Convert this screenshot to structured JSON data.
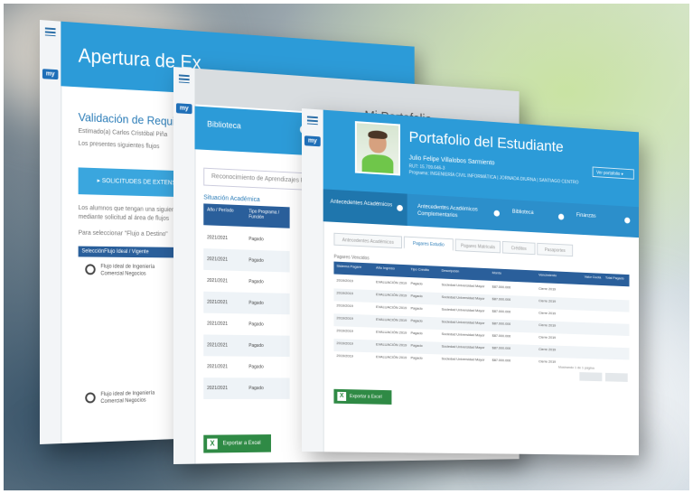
{
  "app": {
    "logo_text": "my"
  },
  "window_admission": {
    "title": "Apertura de Ex",
    "heading": "Validación de Requi",
    "line1": "Estimado(a) Carlos Cristóbal Piña",
    "line2": "Los presentes siguientes flujos",
    "bar_text": "▸ SOLICITUDES DE EXTENSIÓN",
    "line3": "Los alumnos que tengan una siguiente",
    "line4": "mediante solicitud al área de flujos",
    "line5": "Para seleccionar \"Flujo a Destino\"",
    "table_headers": [
      "Selección",
      "Flujo Ideal / Vigente"
    ],
    "rows": [
      {
        "text": "Flujo ideal de Ingeniería Comercial Negocios"
      },
      {
        "text": "Flujo ideal de Ingeniería Comercial Negocios"
      }
    ]
  },
  "window_library": {
    "title": "Mi Portafolio",
    "tab_label": "Biblioteca",
    "search_placeholder": "Reconocimiento de Aprendizajes Previos",
    "subheading": "Situación Académica",
    "table_headers": [
      "Año / Período",
      "Tipo Programa / Función"
    ],
    "rows": [
      {
        "period": "2021/2021",
        "status": "Pagado"
      },
      {
        "period": "2021/2021",
        "status": "Pagado"
      },
      {
        "period": "2021/2021",
        "status": "Pagado"
      },
      {
        "period": "2021/2021",
        "status": "Pagado"
      },
      {
        "period": "2021/2021",
        "status": "Pagado"
      },
      {
        "period": "2021/2021",
        "status": "Pagado"
      },
      {
        "period": "2021/2021",
        "status": "Pagado"
      },
      {
        "period": "2021/2021",
        "status": "Pagado"
      }
    ],
    "excel_button": "Exportar a Excel"
  },
  "window_portfolio": {
    "title": "Portafolio del Estudiante",
    "student_name": "Julio Felipe Villalobos Sarmiento",
    "rut": "RUT: 15.709.646-3",
    "program": "Programa: INGENIERÍA CIVIL INFORMÁTICA  |  JORNADA DIURNA  |  SANTIAGO CENTRO",
    "select_label": "Ver portafolio ▾",
    "nav": [
      {
        "label": "Antecedentes Académicos"
      },
      {
        "label": "Antecedentes Académicos Complementarios"
      },
      {
        "label": "Biblioteca"
      },
      {
        "label": "Finanzas"
      }
    ],
    "subtabs": [
      {
        "label": "Antecedentes Académicos"
      },
      {
        "label": "Pagares Estudio"
      },
      {
        "label": "Pagares Matrícula"
      },
      {
        "label": "Créditos"
      },
      {
        "label": "Pasaportes"
      }
    ],
    "caption": "Pagares Vencidos",
    "table_headers": [
      "Sistema Pagare",
      "Año Ingreso",
      "Tipo Crédito",
      "Descripción",
      "Monto",
      "Vencimiento",
      "Valor Cuota",
      "Total Pagado"
    ],
    "rows": [
      {
        "c1": "2019/2019",
        "c2": "EVALUACIÓN 2019",
        "c3": "Pagado",
        "c4": "Sociedad Universidad Mayor",
        "c5": "$87.000.000",
        "c6": "Cierre 2019"
      },
      {
        "c1": "2019/2019",
        "c2": "EVALUACIÓN 2019",
        "c3": "Pagado",
        "c4": "Sociedad Universidad Mayor",
        "c5": "$87.000.000",
        "c6": "Cierre 2019"
      },
      {
        "c1": "2019/2019",
        "c2": "EVALUACIÓN 2019",
        "c3": "Pagado",
        "c4": "Sociedad Universidad Mayor",
        "c5": "$87.000.000",
        "c6": "Cierre 2019"
      },
      {
        "c1": "2019/2019",
        "c2": "EVALUACIÓN 2019",
        "c3": "Pagado",
        "c4": "Sociedad Universidad Mayor",
        "c5": "$87.000.000",
        "c6": "Cierre 2019"
      },
      {
        "c1": "2019/2019",
        "c2": "EVALUACIÓN 2019",
        "c3": "Pagado",
        "c4": "Sociedad Universidad Mayor",
        "c5": "$87.000.000",
        "c6": "Cierre 2019"
      },
      {
        "c1": "2019/2019",
        "c2": "EVALUACIÓN 2019",
        "c3": "Pagado",
        "c4": "Sociedad Universidad Mayor",
        "c5": "$87.000.000",
        "c6": "Cierre 2019"
      },
      {
        "c1": "2019/2019",
        "c2": "EVALUACIÓN 2019",
        "c3": "Pagado",
        "c4": "Sociedad Universidad Mayor",
        "c5": "$87.000.000",
        "c6": "Cierre 2019"
      }
    ],
    "pager_text": "Mostrando 1 de 1 página",
    "excel_button": "Exportar a Excel"
  },
  "colors": {
    "primary": "#2c9bd8",
    "table_header": "#2a5f9b",
    "excel": "#2f8a45"
  }
}
